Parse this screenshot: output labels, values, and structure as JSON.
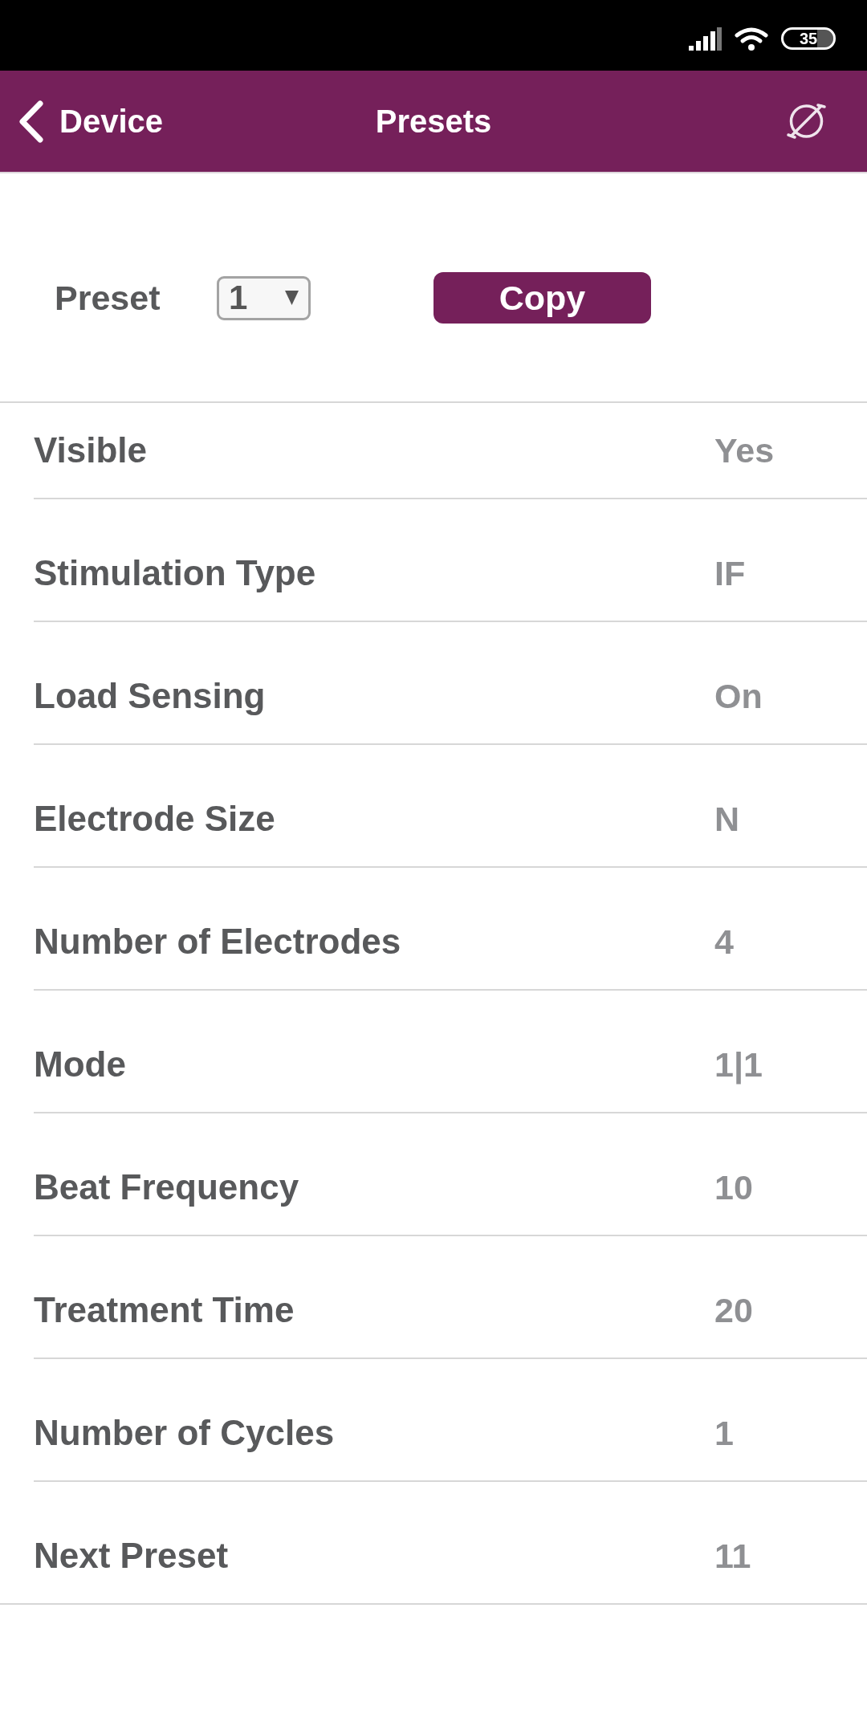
{
  "status_bar": {
    "battery": "35"
  },
  "header": {
    "back_label": "Device",
    "title": "Presets"
  },
  "preset": {
    "label": "Preset",
    "value": "1",
    "button": "Copy"
  },
  "settings": [
    {
      "label": "Visible",
      "value": "Yes"
    },
    {
      "label": "Stimulation Type",
      "value": "IF"
    },
    {
      "label": "Load Sensing",
      "value": "On"
    },
    {
      "label": "Electrode Size",
      "value": "N"
    },
    {
      "label": "Number of Electrodes",
      "value": "4"
    },
    {
      "label": "Mode",
      "value": "1|1"
    },
    {
      "label": "Beat Frequency",
      "value": "10"
    },
    {
      "label": "Treatment Time",
      "value": "20"
    },
    {
      "label": "Number of Cycles",
      "value": "1"
    },
    {
      "label": "Next Preset",
      "value": "11"
    }
  ]
}
